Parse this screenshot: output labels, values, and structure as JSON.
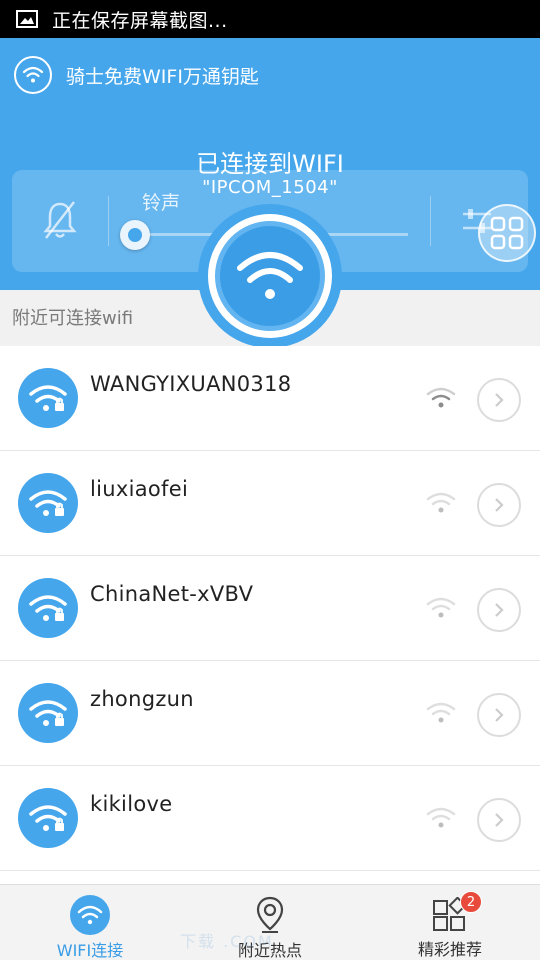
{
  "status_bar": {
    "notification_text": "正在保存屏幕截图...",
    "icon": "picture-icon"
  },
  "header": {
    "app_title": "骑士免费WIFI万通钥匙",
    "connection_title": "已连接到WIFI",
    "connected_ssid": "\"IPCOM_1504\"",
    "ringtone_label": "铃声",
    "ringtone_level": 0.02,
    "colors": {
      "primary": "#45a6ec",
      "accent": "#3a9de6"
    }
  },
  "nearby": {
    "label": "附近可连接wifi"
  },
  "networks": [
    {
      "name": "WANGYIXUAN0318",
      "signal": "medium",
      "secured": true
    },
    {
      "name": "liuxiaofei",
      "signal": "weak",
      "secured": true
    },
    {
      "name": "ChinaNet-xVBV",
      "signal": "weak",
      "secured": true
    },
    {
      "name": "zhongzun",
      "signal": "weak",
      "secured": true
    },
    {
      "name": "kikilove",
      "signal": "weak",
      "secured": true
    }
  ],
  "bottom_nav": {
    "items": [
      {
        "label": "WIFI连接",
        "icon": "wifi-icon",
        "active": true
      },
      {
        "label": "附近热点",
        "icon": "location-pin-icon",
        "active": false
      },
      {
        "label": "精彩推荐",
        "icon": "apps-grid-icon",
        "active": false,
        "badge": "2"
      }
    ]
  },
  "watermark": "下载 .COM"
}
